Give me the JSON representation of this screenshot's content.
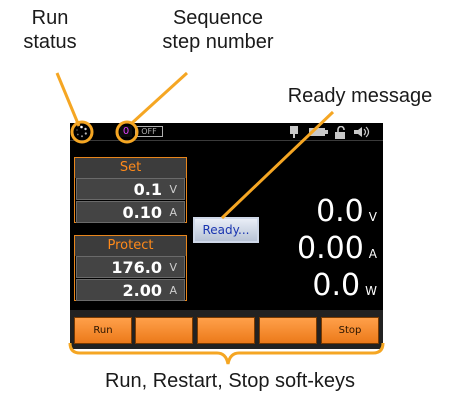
{
  "callouts": {
    "run_status": "Run\nstatus",
    "sequence_step": "Sequence\nstep number",
    "ready_message": "Ready message",
    "soft_keys": "Run, Restart, Stop soft-keys"
  },
  "screen": {
    "sequence_step": "0",
    "output_state": "OFF",
    "set": {
      "label": "Set",
      "voltage": "0.1",
      "voltage_unit": "V",
      "current": "0.10",
      "current_unit": "A"
    },
    "protect": {
      "label": "Protect",
      "voltage": "176.0",
      "voltage_unit": "V",
      "current": "2.00",
      "current_unit": "A"
    },
    "ready_message": "Ready...",
    "measurements": {
      "voltage": "0.0",
      "voltage_unit": "V",
      "current": "0.00",
      "current_unit": "A",
      "power": "0.0",
      "power_unit": "W"
    },
    "softkeys": [
      "Run",
      "",
      "",
      "",
      "Stop"
    ]
  },
  "colors": {
    "accent": "#f5a623",
    "panel_border": "#e8861c",
    "softkey": "#f5922e",
    "sequence_step": "#e040ff",
    "ready_text": "#1a35b0"
  },
  "icons": [
    "run-status-icon",
    "connector-icon",
    "battery-icon",
    "lock-icon",
    "speaker-icon"
  ]
}
